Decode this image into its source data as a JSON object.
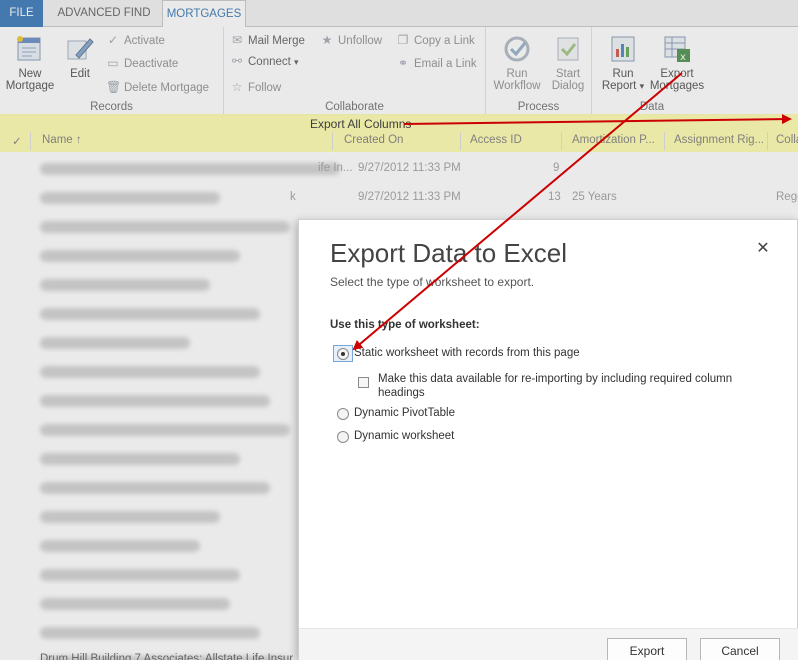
{
  "tabs": [
    {
      "label": "FILE"
    },
    {
      "label": "ADVANCED FIND"
    },
    {
      "label": "MORTGAGES"
    }
  ],
  "ribbon": {
    "records": {
      "label": "Records",
      "new_mortgage": "New Mortgage",
      "edit": "Edit",
      "activate": "Activate",
      "deactivate": "Deactivate",
      "delete": "Delete Mortgage"
    },
    "collaborate": {
      "label": "Collaborate",
      "mail_merge": "Mail Merge",
      "connect": "Connect",
      "follow": "Follow",
      "unfollow": "Unfollow",
      "copy_link": "Copy a Link",
      "email_link": "Email a Link"
    },
    "process": {
      "label": "Process",
      "run_workflow": "Run Workflow",
      "start_dialog": "Start Dialog"
    },
    "data": {
      "label": "Data",
      "run_report": "Run Report",
      "export": "Export Mortgages"
    }
  },
  "annotation": {
    "export_all_columns": "Export All Columns"
  },
  "grid": {
    "columns": [
      "Name ↑",
      "Created On",
      "Access ID",
      "Amortization P...",
      "Assignment Rig...",
      "Colla"
    ],
    "rows": [
      {
        "created": "9/27/2012 11:33 PM",
        "access": "9",
        "amort": "",
        "tail": "ife In..."
      },
      {
        "created": "9/27/2012 11:33 PM",
        "access": "13",
        "amort": "25 Years",
        "tail": "k",
        "extra": "Rege"
      },
      {
        "created": "",
        "access": "",
        "amort": "",
        "tail": ""
      },
      {
        "created": "",
        "access": "",
        "amort": "",
        "tail": ""
      },
      {
        "created": "",
        "access": "",
        "amort": "",
        "tail": ""
      },
      {
        "created": "",
        "access": "",
        "amort": "",
        "tail": ""
      },
      {
        "created": "",
        "access": "",
        "amort": "",
        "tail": ""
      },
      {
        "created": "",
        "access": "",
        "amort": "",
        "tail": ""
      },
      {
        "created": "",
        "access": "",
        "amort": "",
        "tail": ""
      },
      {
        "created": "",
        "access": "",
        "amort": "",
        "tail": ""
      },
      {
        "created": "",
        "access": "",
        "amort": "",
        "tail": ""
      },
      {
        "created": "",
        "access": "",
        "amort": "",
        "tail": ""
      },
      {
        "created": "",
        "access": "",
        "amort": "",
        "tail": ""
      },
      {
        "created": "",
        "access": "",
        "amort": "",
        "tail": ""
      },
      {
        "created": "",
        "access": "",
        "amort": "",
        "tail": ""
      },
      {
        "created": "",
        "access": "",
        "amort": "",
        "tail": ""
      },
      {
        "created": "",
        "access": "",
        "amort": "",
        "tail": ""
      },
      {
        "created": "",
        "access": "",
        "amort": "",
        "tail": ""
      }
    ],
    "last_row_name": "Drum Hill Building 7 Associates; Allstate Life Insur..."
  },
  "dialog": {
    "title": "Export Data to Excel",
    "subtitle": "Select the type of worksheet to export.",
    "section_label": "Use this type of worksheet:",
    "options": {
      "static": "Static worksheet with records from this page",
      "reimport": "Make this data available for re-importing by including required column headings",
      "pivot": "Dynamic PivotTable",
      "dynamic": "Dynamic worksheet"
    },
    "selected": "static",
    "buttons": {
      "export": "Export",
      "cancel": "Cancel"
    }
  },
  "colors": {
    "file_tab": "#2a6fb2",
    "highlight": "#fffd9e",
    "arrow": "#cc0000"
  }
}
